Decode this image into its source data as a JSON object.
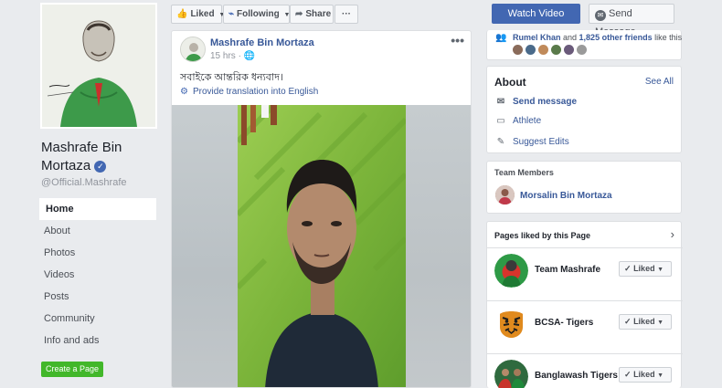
{
  "page": {
    "name_line1": "Mashrafe Bin",
    "name_line2": "Mortaza",
    "verified_icon": "✓",
    "handle": "@Official.Mashrafe"
  },
  "nav": [
    {
      "label": "Home"
    },
    {
      "label": "About"
    },
    {
      "label": "Photos"
    },
    {
      "label": "Videos"
    },
    {
      "label": "Posts"
    },
    {
      "label": "Community"
    },
    {
      "label": "Info and ads"
    }
  ],
  "create_page_label": "Create a Page",
  "actionbar": {
    "liked_label": "Liked",
    "following_label": "Following",
    "share_label": "Share",
    "more_label": "···",
    "watch_video_label": "Watch Video",
    "send_message_label": "Send Message"
  },
  "post": {
    "author": "Mashrafe Bin Mortaza",
    "time": "15 hrs",
    "text": "সবাইকে আন্তরিক ধন্যবাদ।",
    "translate_label": "Provide translation into English",
    "menu": "•••"
  },
  "likes": {
    "friend1": "Rumel Khan",
    "mid": " and ",
    "friends": "1,825 other friends",
    "suffix": " like this"
  },
  "about": {
    "title": "About",
    "see_all": "See All",
    "send_message": "Send message",
    "category": "Athlete",
    "suggest_edits": "Suggest Edits"
  },
  "team": {
    "title": "Team Members",
    "member": "Morsalin Bin Mortaza"
  },
  "liked_pages": {
    "title": "Pages liked by this Page",
    "items": [
      {
        "name": "Team Mashrafe",
        "button": "Liked"
      },
      {
        "name": "BCSA- Tigers",
        "button": "Liked"
      },
      {
        "name": "Banglawash Tigers",
        "button": "Liked"
      }
    ]
  },
  "colors": {
    "brand_blue": "#4267b2",
    "link_blue": "#385898",
    "create_green": "#42b72a",
    "background": "#e9ebee"
  }
}
